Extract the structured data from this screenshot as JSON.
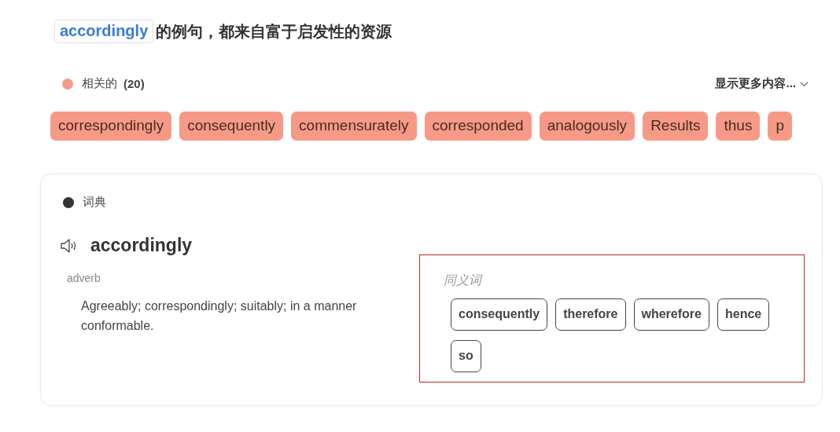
{
  "heading": {
    "word": "accordingly",
    "text": "的例句，都来自富于启发性的资源"
  },
  "related": {
    "label": "相关的",
    "count": "(20)",
    "more": "显示更多内容...",
    "chips": [
      "correspondingly",
      "consequently",
      "commensurately",
      "corresponded",
      "analogously",
      "Results",
      "thus",
      "p"
    ]
  },
  "dictionary": {
    "label": "词典",
    "word": "accordingly",
    "part_of_speech": "adverb",
    "definition": "Agreeably; correspondingly; suitably; in a manner conformable.",
    "synonyms_label": "同义词",
    "synonyms": [
      "consequently",
      "therefore",
      "wherefore",
      "hence",
      "so"
    ]
  }
}
